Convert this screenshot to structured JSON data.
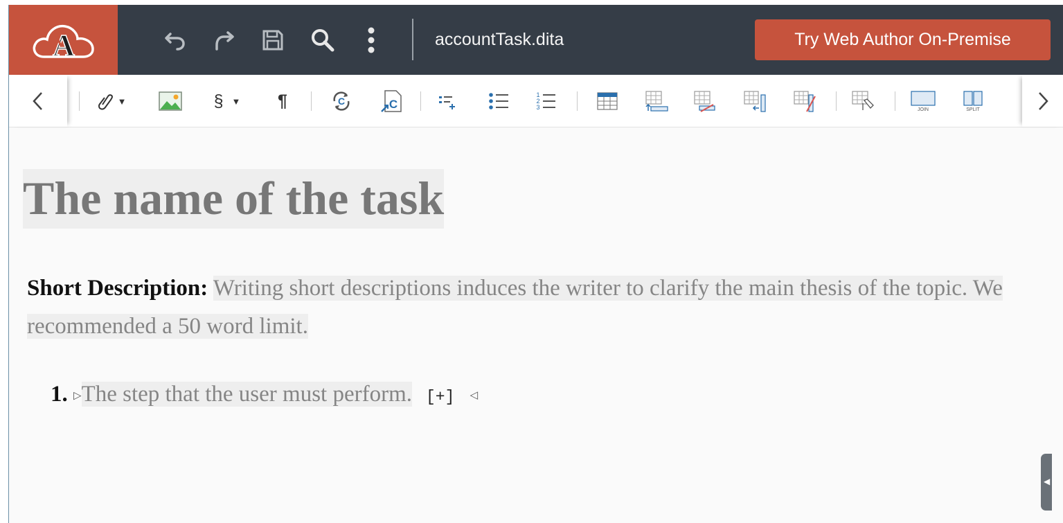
{
  "header": {
    "logo_letter": "A",
    "filename": "accountTask.dita",
    "try_button_label": "Try Web Author On-Premise",
    "icons": [
      "undo-icon",
      "redo-icon",
      "save-icon",
      "search-icon",
      "more-vertical-icon"
    ]
  },
  "toolbar": {
    "icons": [
      "link-icon",
      "image-icon",
      "section-icon",
      "paragraph-icon",
      "conref-icon",
      "conref-push-icon",
      "insert-list-item-icon",
      "unordered-list-icon",
      "ordered-list-icon",
      "table-icon",
      "insert-row-icon",
      "delete-row-icon",
      "insert-column-icon",
      "delete-column-icon",
      "table-properties-icon",
      "join-cells-icon",
      "split-cell-icon"
    ],
    "section_symbol": "§",
    "paragraph_symbol": "¶",
    "join_label": "JOIN",
    "split_label": "SPLIT"
  },
  "document": {
    "title": "The name of the task",
    "shortdesc_label": "Short Description:",
    "shortdesc_text": "Writing short descriptions induces the writer to clarify the main thesis of the topic. We recommended a 50 word limit.",
    "step_number": "1.",
    "step_text": "The step that the user must perform.",
    "step_expand": "[+]"
  },
  "colors": {
    "header_bg": "#353d47",
    "accent": "#c6533d",
    "toolbar_icon_blue": "#2a6fad",
    "placeholder_text": "#858585"
  }
}
